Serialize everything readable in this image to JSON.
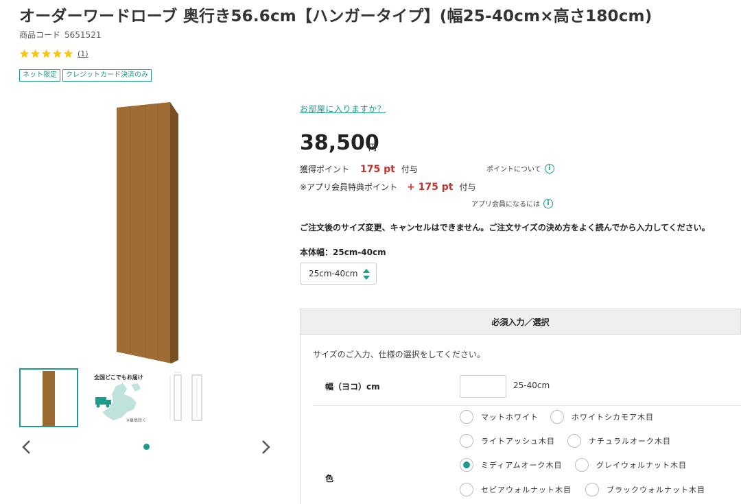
{
  "product": {
    "title": "オーダーワードローブ 奥行き56.6cm【ハンガータイプ】(幅25-40cm×高さ180cm)",
    "code_label": "商品コード",
    "code": "5651521",
    "rating_stars": 5,
    "review_count": "(1)",
    "tags": [
      "ネット限定",
      "クレジットカード決済のみ"
    ]
  },
  "gallery": {
    "thumb2_title": "全国どこでもお届け",
    "thumb2_note": "※離島除く",
    "active_index": 0,
    "prev_icon": "chevron-left-icon",
    "next_icon": "chevron-right-icon"
  },
  "purchase": {
    "room_link": "お部屋に入りますか？",
    "price": "38,500",
    "price_unit": "円",
    "points": {
      "label": "獲得ポイント",
      "value": "175 pt",
      "suffix": "付与",
      "info_label": "ポイントについて"
    },
    "app_points": {
      "label": "※アプリ会員特典ポイント",
      "value": "+ 175 pt",
      "suffix": "付与",
      "info_label": "アプリ会員になるには"
    },
    "notice": "ご注文後のサイズ変更、キャンセルはできません。ご注文サイズの決め方をよく読んでから入力してください。",
    "width_label": "本体幅：25cm-40cm",
    "width_select": "25cm-40cm"
  },
  "options": {
    "header": "必須入力／選択",
    "description": "サイズのご入力、仕様の選択をしてください。",
    "width_field_label": "幅（ヨコ）cm",
    "width_field_value": "",
    "width_range": "25-40cm",
    "color_label": "色",
    "colors": [
      {
        "label": "マットホワイト",
        "selected": false
      },
      {
        "label": "ホワイトシカモア木目",
        "selected": false
      },
      {
        "label": "ライトアッシュ木目",
        "selected": false
      },
      {
        "label": "ナチュラルオーク木目",
        "selected": false
      },
      {
        "label": "ミディアムオーク木目",
        "selected": true
      },
      {
        "label": "グレイウォルナット木目",
        "selected": false
      },
      {
        "label": "セピアウォルナット木目",
        "selected": false
      },
      {
        "label": "ブラックウォルナット木目",
        "selected": false
      }
    ]
  },
  "colors": {
    "accent": "#1d9b8c",
    "points": "#c8302a",
    "wood": "#9a6a30",
    "star": "#f5c518"
  }
}
